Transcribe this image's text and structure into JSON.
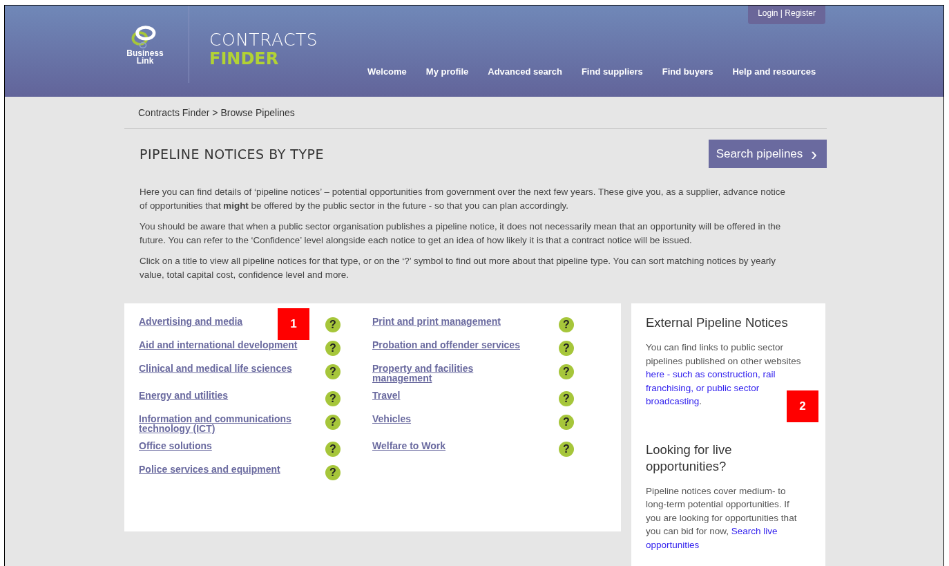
{
  "header": {
    "logo_lines": [
      "Business",
      "Link"
    ],
    "title": "CONTRACTS",
    "subtitle": "FINDER",
    "login": "Login | Register",
    "nav": [
      "Welcome",
      "My profile",
      "Advanced search",
      "Find suppliers",
      "Find buyers",
      "Help and resources"
    ]
  },
  "breadcrumb": "Contracts Finder > Browse Pipelines",
  "heading": "PIPELINE NOTICES BY TYPE",
  "search_button": {
    "label": "Search pipelines",
    "icon": "›"
  },
  "intro": [
    "Here you can find details of ‘pipeline notices’ – potential opportunities from government over the next few years. These give you, as a supplier, advance notice of opportunities that **might** be offered by the public sector in the future - so that you can plan accordingly.",
    "You should be aware that when a public sector organisation publishes a pipeline notice, it does not necessarily mean that an opportunity will be offered in the future. You can refer to the ‘Confidence’ level alongside each notice to get an idea of how likely it is that a contract notice will be issued.",
    "Click on a title to view all pipeline notices for that type, or on the ‘?’ symbol to find out more about that pipeline type. You can sort matching notices by yearly value, total capital cost, confidence level and more."
  ],
  "pipeline_types": [
    {
      "left": {
        "label": "Advertising and media",
        "help": "?"
      },
      "right": {
        "label": "Print and print management",
        "help": "?"
      }
    },
    {
      "left": {
        "label": "Aid and international development",
        "help": "?"
      },
      "right": {
        "label": "Probation and offender services",
        "help": "?"
      }
    },
    {
      "left": {
        "label": "Clinical and medical life sciences",
        "help": "?"
      },
      "right": {
        "label": "Property and facilities management",
        "help": "?"
      }
    },
    {
      "left": {
        "label": "Energy and utilities",
        "help": "?"
      },
      "right": {
        "label": "Travel",
        "help": "?"
      }
    },
    {
      "left": {
        "label": "Information and communications technology (ICT)",
        "help": "?"
      },
      "right": {
        "label": "Vehicles",
        "help": "?"
      }
    },
    {
      "left": {
        "label": "Office solutions",
        "help": "?"
      },
      "right": {
        "label": "Welfare to Work",
        "help": "?"
      }
    },
    {
      "left": {
        "label": "Police services and equipment",
        "help": "?"
      }
    }
  ],
  "sidebar": [
    {
      "title": "External Pipeline Notices",
      "text_before": "You can find links to public sector pipelines published on other websites",
      "link_lines": [
        "here - such as construction, rail",
        "franchising, or public sector",
        "broadcasting"
      ],
      "text_after": "."
    },
    {
      "title": "Looking for live opportunities?",
      "text_before": "Pipeline notices cover medium- to long-term potential opportunities. If you are looking for opportunities that you can bid for now,",
      "link_lines": [
        "Search live",
        "opportunities"
      ]
    }
  ],
  "callouts": [
    "1",
    "2"
  ]
}
